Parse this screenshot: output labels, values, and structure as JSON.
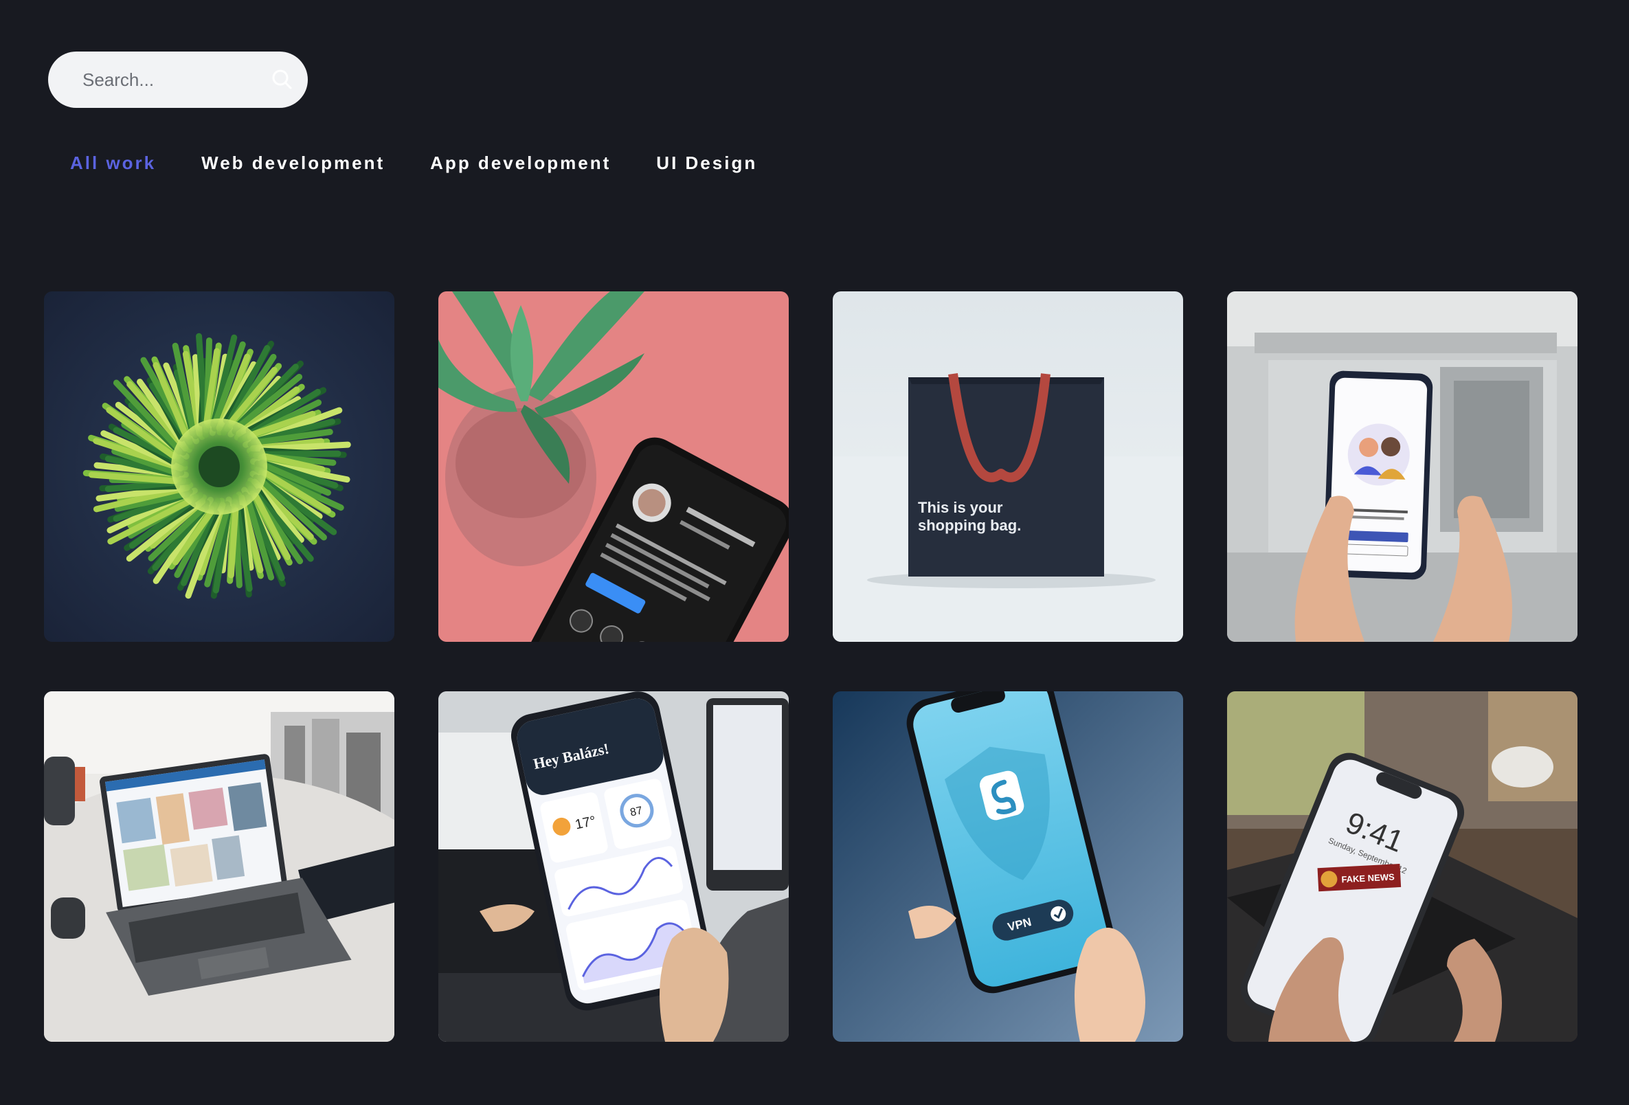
{
  "search": {
    "placeholder": "Search...",
    "icon": "search-icon"
  },
  "tabs": [
    {
      "label": "All work",
      "active": true
    },
    {
      "label": "Web development",
      "active": false
    },
    {
      "label": "App development",
      "active": false
    },
    {
      "label": "UI Design",
      "active": false
    }
  ],
  "colors": {
    "background": "#181a21",
    "accent": "#5b63e0",
    "search_bg": "#f2f3f5"
  },
  "portfolio": {
    "items": [
      {
        "image": "green-straws-burst"
      },
      {
        "image": "succulent-phone-instagram"
      },
      {
        "image": "shopping-bag",
        "caption_line1": "This is your",
        "caption_line2": "shopping bag."
      },
      {
        "image": "phone-microsoft-teams"
      },
      {
        "image": "laptop-on-table"
      },
      {
        "image": "phone-weather-app",
        "greeting": "Hey Balázs!",
        "temp": "17°",
        "aqi": "87"
      },
      {
        "image": "phone-vpn-app",
        "badge": "VPN"
      },
      {
        "image": "phone-lockscreen",
        "time": "9:41",
        "date": "Sunday, September 12",
        "sticker": "FAKE NEWS"
      }
    ]
  }
}
